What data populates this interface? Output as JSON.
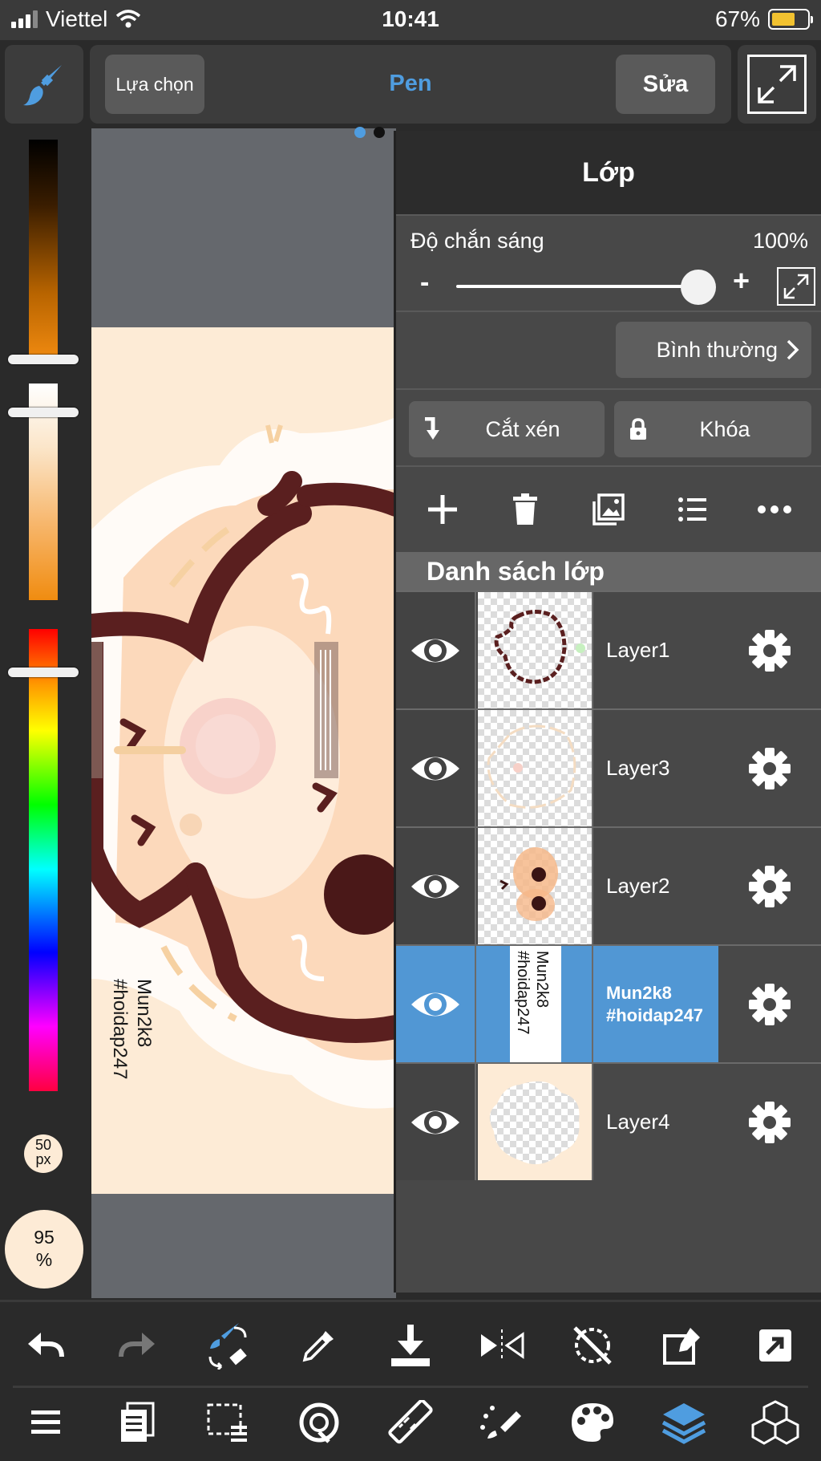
{
  "status_bar": {
    "carrier": "Viettel",
    "time": "10:41",
    "battery": "67%",
    "battery_level": 0.67
  },
  "toolbar": {
    "brush_icon": "paintbrush-icon",
    "select_label": "Lựa chọn",
    "tool_name": "Pen",
    "edit_label": "Sửa",
    "fullscreen_icon": "expand-icon"
  },
  "color_panel": {
    "brush_size": "50\npx",
    "opacity": "95\n%"
  },
  "canvas": {
    "watermark": "Mun2k8\n#hoidap247"
  },
  "layer_panel": {
    "title": "Lớp",
    "opacity_label": "Độ chắn sáng",
    "opacity_value": "100%",
    "opacity_level": 1.0,
    "minus": "-",
    "plus": "+",
    "blend_mode": "Bình thường",
    "clipping_label": "Cắt xén",
    "lock_label": "Khóa",
    "action_icons": [
      "plus-icon",
      "trash-icon",
      "image-icon",
      "list-icon",
      "more-icon"
    ],
    "list_header": "Danh sách lớp",
    "layers": [
      {
        "name": "Layer1",
        "visible": true,
        "selected": false
      },
      {
        "name": "Layer3",
        "visible": true,
        "selected": false
      },
      {
        "name": "Layer2",
        "visible": true,
        "selected": false
      },
      {
        "name": "Mun2k8\n#hoidap247",
        "visible": true,
        "selected": true
      },
      {
        "name": "Layer4",
        "visible": true,
        "selected": false
      }
    ]
  },
  "bottom_toolbar": {
    "row1_icons": [
      "undo-icon",
      "redo-icon",
      "brush-eraser-swap-icon",
      "eyedropper-icon",
      "download-icon",
      "flip-icon",
      "rotate-off-icon",
      "transform-icon",
      "share-icon"
    ],
    "row2_icons": [
      "menu-icon",
      "pages-icon",
      "selection-icon",
      "snap-icon",
      "ruler-icon",
      "fill-icon",
      "palette-icon",
      "layers-icon",
      "materials-icon"
    ]
  },
  "colors": {
    "accent": "#4f9de0",
    "selected_layer": "#5197d4",
    "canvas_bg": "#fdebd6",
    "line_art": "#5a1f1f"
  }
}
